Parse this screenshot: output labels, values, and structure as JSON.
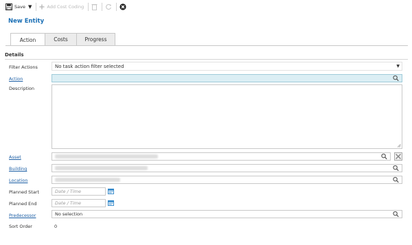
{
  "toolbar": {
    "save_label": "Save",
    "add_cost_coding_label": "Add Cost Coding"
  },
  "entity_title": "New Entity",
  "tabs": [
    {
      "label": "Action",
      "active": true
    },
    {
      "label": "Costs",
      "active": false
    },
    {
      "label": "Progress",
      "active": false
    }
  ],
  "section_title": "Details",
  "form": {
    "filter_actions": {
      "label": "Filter Actions",
      "value": "No task action filter selected"
    },
    "action": {
      "label": "Action",
      "value": ""
    },
    "description": {
      "label": "Description",
      "value": ""
    },
    "asset": {
      "label": "Asset"
    },
    "building": {
      "label": "Building"
    },
    "location": {
      "label": "Location"
    },
    "planned_start": {
      "label": "Planned Start",
      "placeholder": "Date / Time"
    },
    "planned_end": {
      "label": "Planned End",
      "placeholder": "Date / Time"
    },
    "predecessor": {
      "label": "Predecessor",
      "value": "No selection"
    },
    "sort_order": {
      "label": "Sort Order",
      "value": "0"
    }
  },
  "colors": {
    "title_blue": "#1a6fb5",
    "link_blue": "#1d5fa5",
    "active_field_bg": "#dbeef4",
    "calendar_icon": "#2f86c9"
  }
}
